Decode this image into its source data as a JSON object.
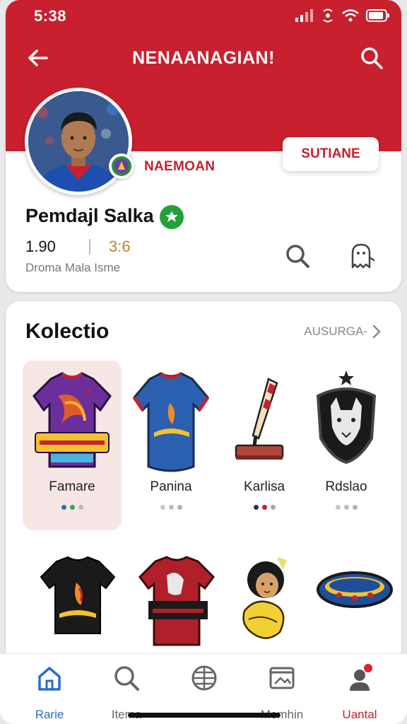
{
  "status_bar": {
    "time": "5:38"
  },
  "header": {
    "title": "NENAANAGIAN!"
  },
  "profile": {
    "team_name": "NAEMOAN",
    "subscribe_label": "SUTIANE",
    "name": "Pemdajl Salka",
    "stat1_value": "1.90",
    "stat2_value": "3:6",
    "stat_labels": "Droma Mala  Isme"
  },
  "collection": {
    "title": "Kolectio",
    "see_all_label": "AUSURGA-",
    "items": [
      {
        "label": "Famare",
        "dots": [
          "#2a6fc2",
          "#2ea84a",
          "#b9b9b9"
        ]
      },
      {
        "label": "Panina",
        "dots": [
          "#c9c9c9",
          "#bdbdbd",
          "#b3b3b3"
        ]
      },
      {
        "label": "Karlisa",
        "dots": [
          "#1e3566",
          "#c8202f",
          "#a6a6a6"
        ]
      },
      {
        "label": "Rdslao",
        "dots": [
          "#c9c9c9",
          "#bdbdbd",
          "#b3b3b3"
        ]
      }
    ]
  },
  "bottom_nav": [
    {
      "label": "Rarie",
      "icon": "home-icon"
    },
    {
      "label": "Itema",
      "icon": "search-icon"
    },
    {
      "label": "",
      "icon": "globe-icon"
    },
    {
      "label": "Memhin",
      "icon": "gallery-icon"
    },
    {
      "label": "Uantal",
      "icon": "account-icon"
    }
  ],
  "colors": {
    "brand_red": "#c8202f",
    "active_blue": "#2a6fc2",
    "verified_green": "#22a03a"
  }
}
